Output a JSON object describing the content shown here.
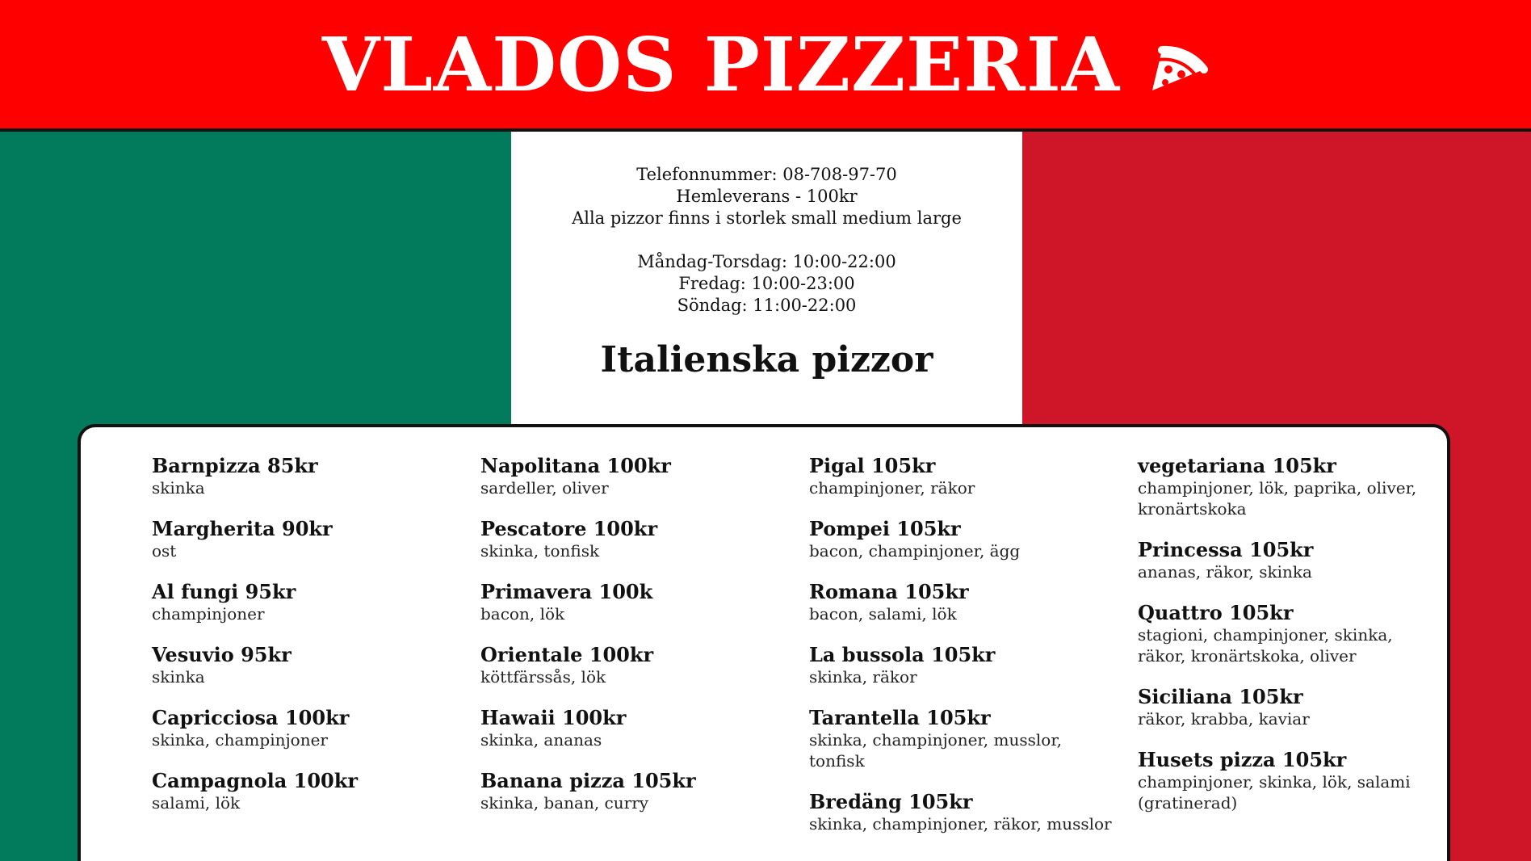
{
  "header": {
    "title": "VLADOS PIZZERIA",
    "icon": "pizza-slice-icon",
    "background": "#ff0000"
  },
  "flag_colors": {
    "green": "#027a5c",
    "white": "#ffffff",
    "red": "#cf1528"
  },
  "info": {
    "phone": "Telefonnummer: 08-708-97-70",
    "delivery": "Hemleverans - 100kr",
    "sizes": "Alla pizzor finns i storlek small medium large",
    "hours_mon_thu": "Måndag-Torsdag: 10:00-22:00",
    "hours_fri": "Fredag: 10:00-23:00",
    "hours_sun": "Söndag: 11:00-22:00"
  },
  "section_title": "Italienska pizzor",
  "menu": {
    "columns": [
      [
        {
          "name": "Barnpizza 85kr",
          "desc": "skinka"
        },
        {
          "name": "Margherita 90kr",
          "desc": "ost"
        },
        {
          "name": "Al fungi 95kr",
          "desc": "champinjoner"
        },
        {
          "name": "Vesuvio 95kr",
          "desc": "skinka"
        },
        {
          "name": "Capricciosa 100kr",
          "desc": "skinka, champinjoner"
        },
        {
          "name": "Campagnola 100kr",
          "desc": "salami, lök"
        }
      ],
      [
        {
          "name": "Napolitana 100kr",
          "desc": "sardeller, oliver"
        },
        {
          "name": "Pescatore 100kr",
          "desc": "skinka, tonfisk"
        },
        {
          "name": "Primavera 100k",
          "desc": "bacon, lök"
        },
        {
          "name": "Orientale 100kr",
          "desc": "köttfärssås, lök"
        },
        {
          "name": "Hawaii 100kr",
          "desc": "skinka, ananas"
        },
        {
          "name": "Banana pizza 105kr",
          "desc": "skinka, banan, curry"
        }
      ],
      [
        {
          "name": "Pigal 105kr",
          "desc": "champinjoner, räkor"
        },
        {
          "name": "Pompei 105kr",
          "desc": "bacon, champinjoner, ägg"
        },
        {
          "name": "Romana 105kr",
          "desc": "bacon, salami, lök"
        },
        {
          "name": "La bussola 105kr",
          "desc": "skinka, räkor"
        },
        {
          "name": "Tarantella 105kr",
          "desc": "skinka, champinjoner, musslor, tonfisk"
        },
        {
          "name": "Bredäng 105kr",
          "desc": "skinka, champinjoner, räkor, musslor"
        }
      ],
      [
        {
          "name": "vegetariana 105kr",
          "desc": "champinjoner, lök, paprika, oliver, kronärtskoka"
        },
        {
          "name": "Princessa 105kr",
          "desc": "ananas, räkor, skinka"
        },
        {
          "name": "Quattro 105kr",
          "desc": "stagioni, champinjoner, skinka, räkor, kronärtskoka, oliver"
        },
        {
          "name": "Siciliana 105kr",
          "desc": "räkor, krabba, kaviar"
        },
        {
          "name": "Husets pizza 105kr",
          "desc": "champinjoner, skinka, lök, salami (gratinerad)"
        }
      ]
    ]
  }
}
